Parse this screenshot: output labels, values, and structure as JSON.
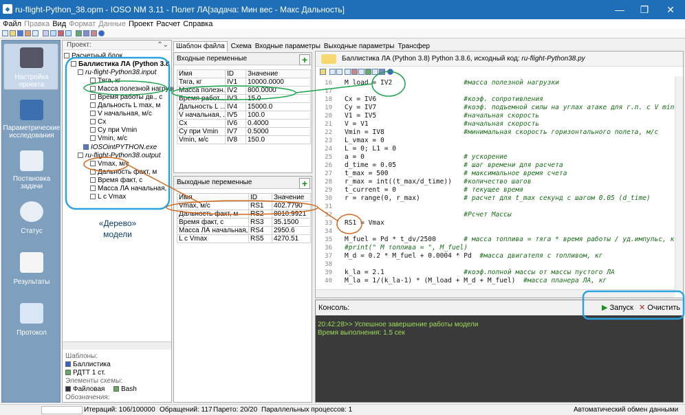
{
  "window": {
    "title": "ru-flight-Python_38.opm - IOSO NM 3.11 - Полет ЛА[задача: Мин вес - Макс Дальность]"
  },
  "menu": [
    "Файл",
    "Правка",
    "Вид",
    "Формат",
    "Данные",
    "Проект",
    "Расчет",
    "Справка"
  ],
  "leftnav": [
    {
      "label": "Настройка проекта",
      "icon": "gear-icon"
    },
    {
      "label": "Параметрические исследования",
      "icon": "parameters-icon"
    },
    {
      "label": "Постановка задачи",
      "icon": "clipboard-icon"
    },
    {
      "label": "Статус",
      "icon": "stopwatch-icon"
    },
    {
      "label": "Результаты",
      "icon": "results-chart-icon"
    },
    {
      "label": "Протокол",
      "icon": "protocol-icon"
    }
  ],
  "project": {
    "header": "Проект:",
    "tree": [
      "Расчетный блок",
      "Баллистика ЛА (Python 3.8",
      "ru-flight-Python38.input",
      "Тяга, кг",
      "Масса полезной нагрузки",
      "Время работы дв., с",
      "Дальность L max, м",
      "V начальная, м/с",
      "Cx",
      "Cy при Vmin",
      "Vmin, м/с",
      "IOSOintPYTHON.exe",
      "ru-flight-Python38.output",
      "Vmax, м/с",
      "Дальность факт, м",
      "Время факт, с",
      "Масса ЛА начальная, г",
      "L с Vmax"
    ],
    "tree_label": "«Дерево» модели",
    "lower": [
      "Шаблоны:",
      "Баллистика",
      "РДТТ 1 ст.",
      "Элементы схемы:",
      "Файловая",
      "Bash",
      "Обозначения:"
    ]
  },
  "tabs": [
    "Шаблон файла",
    "Схема",
    "Входные параметры",
    "Выходные параметры",
    "Трансфер"
  ],
  "inputs": {
    "title": "Входные переменные",
    "headers": [
      "Имя",
      "ID",
      "Значение"
    ],
    "rows": [
      [
        "Тяга, кг",
        "IV1",
        "10000.0000"
      ],
      [
        "Масса полезн...",
        "IV2",
        "800.0000"
      ],
      [
        "Время работ...",
        "IV3",
        "15.0"
      ],
      [
        "Дальность L ...",
        "IV4",
        "15000.0"
      ],
      [
        "V начальная, ...",
        "IV5",
        "100.0"
      ],
      [
        "Cx",
        "IV6",
        "0.4000"
      ],
      [
        "Cy при Vmin",
        "IV7",
        "0.5000"
      ],
      [
        "Vmin, м/с",
        "IV8",
        "150.0"
      ]
    ]
  },
  "outputs": {
    "title": "Выходные переменные",
    "headers": [
      "Имя",
      "ID",
      "Значение"
    ],
    "rows": [
      [
        "Vmax, м/с",
        "RS1",
        "402.7790"
      ],
      [
        "Дальность факт, м",
        "RS2",
        "8010.9921"
      ],
      [
        "Время факт, с",
        "RS3",
        "35.1500"
      ],
      [
        "Масса ЛА начальная, ...",
        "RS4",
        "2950.6"
      ],
      [
        "L с Vmax",
        "RS5",
        "4270.51"
      ]
    ]
  },
  "code": {
    "header_label": "Баллистика ЛА (Python 3.8) Python 3.8.6, исходный код:",
    "file": "ru-flight-Python38.py",
    "lines": [
      {
        "n": "16",
        "code": "M_load = IV2",
        "cm": "#масса полезной нагрузки"
      },
      {
        "n": "17",
        "code": "",
        "cm": ""
      },
      {
        "n": "18",
        "code": "Cx = IV6",
        "cm": "#коэф. сопротивления"
      },
      {
        "n": "19",
        "code": "Cy = IV7",
        "cm": "#коэф. подъемной силы на углах атаке для г.п. с V min"
      },
      {
        "n": "20",
        "code": "V1 = IV5",
        "cm": "#начальная скорость"
      },
      {
        "n": "21",
        "code": "V = V1",
        "cm": "#начальная скорость"
      },
      {
        "n": "22",
        "code": "Vmin = IV8",
        "cm": "#минимальная скорость горизонтального полета, м/с"
      },
      {
        "n": "23",
        "code": "L_vmax = 0",
        "cm": ""
      },
      {
        "n": "24",
        "code": "L = 0; L1 = 0",
        "cm": ""
      },
      {
        "n": "25",
        "code": "a = 0",
        "cm": "# ускорение"
      },
      {
        "n": "26",
        "code": "d_time = 0.05",
        "cm": "# шаг времени для расчета"
      },
      {
        "n": "27",
        "code": "t_max = 500",
        "cm": "# максимальное время счета"
      },
      {
        "n": "28",
        "code": "r_max = int((t_max/d_time))",
        "cm": "#количество шагов"
      },
      {
        "n": "29",
        "code": "t_current = 0",
        "cm": "# текущее время"
      },
      {
        "n": "30",
        "code": "r = range(0, r_max)",
        "cm": "# расчет для t_max секунд с шагом 0.05 (d_time)"
      },
      {
        "n": "31",
        "code": "",
        "cm": ""
      },
      {
        "n": "32",
        "code": "     ",
        "cm": "#Рсчет Массы"
      },
      {
        "n": "33",
        "code": "RS1 = Vmax",
        "cm": ""
      },
      {
        "n": "34",
        "code": "",
        "cm": ""
      },
      {
        "n": "35",
        "code": "M_fuel = Pd * t_dv/2500",
        "cm": "# масса топлива = тяга * время работы / уд.импульс, кг"
      },
      {
        "n": "36",
        "code": "",
        "cm": "#print(\" M топлива = \", M_fuel)"
      },
      {
        "n": "37",
        "code": "M_d = 0.2 * M_fuel + 0.0004 * Pd",
        "cm": "#масса двигателя с топливом, кг"
      },
      {
        "n": "38",
        "code": "",
        "cm": ""
      },
      {
        "n": "39",
        "code": "k_la = 2.1",
        "cm": "#коэф.полной массы от массы пустого ЛА"
      },
      {
        "n": "40",
        "code": "M_la = 1/(k_la-1) * (M_load + M_d + M_fuel)",
        "cm": "#масса планера ЛА, кг"
      }
    ]
  },
  "console": {
    "title": "Консоль:",
    "run": "Запуск",
    "clear": "Очистить",
    "line1": "20:42:28>> Успешное завершение работы модели",
    "line2": "Время выполнения: 1.5 сек"
  },
  "status": {
    "iter": "Итераций: 106/100000",
    "calls": "Обращений: 117",
    "pareto": "Парето: 20/20",
    "parallel": "Параллельных процессов: 1",
    "auto": "Автоматический обмен данными"
  }
}
